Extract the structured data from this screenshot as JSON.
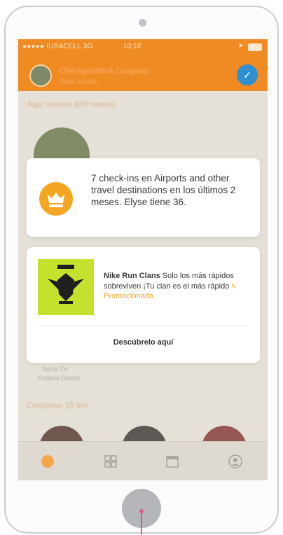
{
  "status_bar": {
    "carrier": "●●●●● IUSACELL 3G",
    "time": "10:18"
  },
  "header": {
    "user_name": "Checkpointer4 Coupons",
    "user_subtitle": "Santa Juliana"
  },
  "feed": {
    "section_nearby": "Aquí mismo 300 metros",
    "section_close": "Cercanos 15 km",
    "place_label_1": "Santa Fe",
    "place_label_2": "Federal District"
  },
  "achievement_card": {
    "icon": "crown-icon",
    "text": "7 check-ins en Airports and other travel destinations en los últimos 2 meses. Elyse tiene 36."
  },
  "promo_card": {
    "brand": "Nike Run Clans",
    "body": "Solo los más rápidos sobreviven ¡Tu clan es el más rápido",
    "promoted_label": "Promocionado",
    "cta": "Descúbrelo aquí"
  },
  "tabs": [
    {
      "icon": "checkin-icon"
    },
    {
      "icon": "grid-icon"
    },
    {
      "icon": "calendar-icon"
    },
    {
      "icon": "profile-icon"
    }
  ],
  "colors": {
    "header_orange": "#f08a23",
    "badge_yellow": "#f4a623",
    "check_blue": "#2e8fd1",
    "promo_green": "#c6e02e",
    "pointer_pink": "#e05a88"
  }
}
